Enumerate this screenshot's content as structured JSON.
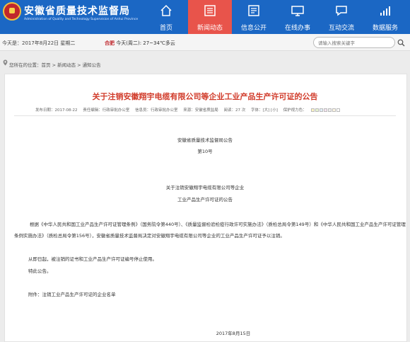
{
  "header": {
    "site_title": "安徽省质量技术监督局",
    "site_subtitle": "Administration of Quality and Technology Supervision of Anhui Province",
    "nav": [
      {
        "label": "首页",
        "icon": "home-icon"
      },
      {
        "label": "新闻动态",
        "icon": "news-icon"
      },
      {
        "label": "信息公开",
        "icon": "list-icon"
      },
      {
        "label": "在线办事",
        "icon": "monitor-icon"
      },
      {
        "label": "互动交流",
        "icon": "chat-icon"
      },
      {
        "label": "数据服务",
        "icon": "chart-icon"
      }
    ],
    "active_nav_color": "#e8544b",
    "brand_color": "#1b67c4"
  },
  "topbar": {
    "date": "今天是：2017年8月22日  星期二",
    "city": "合肥",
    "weather": "今天(周二): 27~34℃多云",
    "search_placeholder": "请输入搜索关键字"
  },
  "breadcrumb": "您所在的位置：首页 > 新闻动态 > 通知公告",
  "article": {
    "title": "关于注销安徽翔宇电缆有限公司等企业工业产品生产许可证的公告",
    "meta": {
      "date": "发布日期：2017-08-22",
      "editor": "责任编辑：行政审批办公室",
      "info": "信息员：行政审批办公室",
      "source": "来源：安徽省质监局",
      "views": "阅读：27 次",
      "fontsize": "字体：[大] [小]",
      "protect": "保护视力色："
    },
    "org": "安徽省质量技术监督局公告",
    "number": "第10号",
    "subject_line1": "关于注销安徽翔宇电缆有限公司等企业",
    "subject_line2": "工业产品生产许可证的公告",
    "body": "根据《中华人民共和国工业产品生产许可证管理条例》（国务院令第440号）、《质量监督检验检疫行政许可实施办法》（质检总局令第149号）和《中华人民共和国工业产品生产许可证管理条例实施办法》（质检总局令第156号），安徽省质量技术监督局决定对安徽翔宇电缆有限公司等企业的工业产品生产许可证予以注销。",
    "line2": "从即日起，被注销的证书和工业产品生产许可证编号停止使用。",
    "line3": "特此公告。",
    "attachment": "附件：注销工业产品生产许可证的企业名单",
    "sign_date": "2017年8月15日"
  },
  "protect_colors": [
    "#fff4c2",
    "#e7f5d0",
    "#e0eef8",
    "#f6e4f0",
    "#eeeeee",
    "#fdf6e3",
    "#ffffff"
  ]
}
